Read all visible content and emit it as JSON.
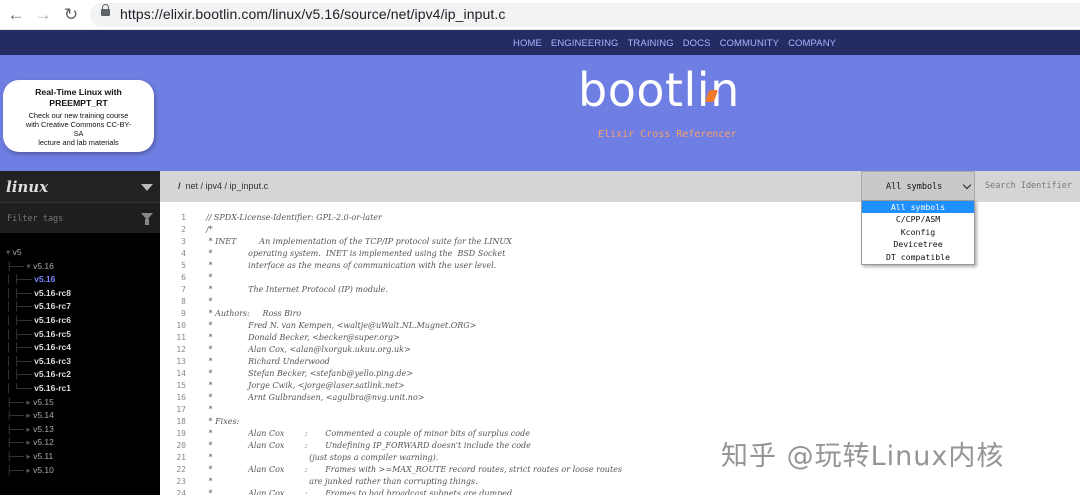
{
  "browser": {
    "url": "https://elixir.bootlin.com/linux/v5.16/source/net/ipv4/ip_input.c",
    "back_icon": "←",
    "forward_icon": "→",
    "reload_icon": "↻"
  },
  "topnav": [
    "HOME",
    "ENGINEERING",
    "TRAINING",
    "DOCS",
    "COMMUNITY",
    "COMPANY"
  ],
  "header": {
    "logo": "bootlin",
    "subtitle": "Elixir Cross Referencer"
  },
  "promo": {
    "title1": "Real-Time Linux with",
    "title2": "PREEMPT_RT",
    "body": [
      "Check our new training course",
      "with Creative Commons CC-BY-",
      "SA",
      "lecture and lab materials"
    ]
  },
  "sidebar": {
    "project": "linux",
    "filter_placeholder": "Filter tags",
    "tree": [
      {
        "lead": "▾ ",
        "text": "v5",
        "cls": ""
      },
      {
        "lead": "├── ▾ ",
        "text": "v5.16",
        "cls": ""
      },
      {
        "lead": "│   ├── ",
        "text": "v5.16",
        "cls": "sel"
      },
      {
        "lead": "│   ├── ",
        "text": "v5.16-rc8",
        "cls": "tag"
      },
      {
        "lead": "│   ├── ",
        "text": "v5.16-rc7",
        "cls": "tag"
      },
      {
        "lead": "│   ├── ",
        "text": "v5.16-rc6",
        "cls": "tag"
      },
      {
        "lead": "│   ├── ",
        "text": "v5.16-rc5",
        "cls": "tag"
      },
      {
        "lead": "│   ├── ",
        "text": "v5.16-rc4",
        "cls": "tag"
      },
      {
        "lead": "│   ├── ",
        "text": "v5.16-rc3",
        "cls": "tag"
      },
      {
        "lead": "│   ├── ",
        "text": "v5.16-rc2",
        "cls": "tag"
      },
      {
        "lead": "│   └── ",
        "text": "v5.16-rc1",
        "cls": "tag"
      },
      {
        "lead": "├── ▸ ",
        "text": "v5.15",
        "cls": ""
      },
      {
        "lead": "├── ▸ ",
        "text": "v5.14",
        "cls": ""
      },
      {
        "lead": "├── ▸ ",
        "text": "v5.13",
        "cls": ""
      },
      {
        "lead": "├── ▸ ",
        "text": "v5.12",
        "cls": ""
      },
      {
        "lead": "├── ▸ ",
        "text": "v5.11",
        "cls": ""
      },
      {
        "lead": "├── ▸ ",
        "text": "v5.10",
        "cls": ""
      }
    ]
  },
  "breadcrumb": {
    "root": "/",
    "path": "net / ipv4 / ip_input.c"
  },
  "symbols": {
    "selected": "All symbols",
    "options": [
      "All symbols",
      "C/CPP/ASM",
      "Kconfig",
      "Devicetree",
      "DT compatible"
    ],
    "search_placeholder": "Search Identifier"
  },
  "code": [
    {
      "n": "1",
      "t": "// SPDX-License-Identifier: GPL-2.0-or-later"
    },
    {
      "n": "2",
      "t": "/*"
    },
    {
      "n": "3",
      "t": " * INET         An implementation of the TCP/IP protocol suite for the LINUX"
    },
    {
      "n": "4",
      "t": " *              operating system.  INET is implemented using the  BSD Socket"
    },
    {
      "n": "5",
      "t": " *              interface as the means of communication with the user level."
    },
    {
      "n": "6",
      "t": " *"
    },
    {
      "n": "7",
      "t": " *              The Internet Protocol (IP) module."
    },
    {
      "n": "8",
      "t": " *"
    },
    {
      "n": "9",
      "t": " * Authors:     Ross Biro"
    },
    {
      "n": "10",
      "t": " *              Fred N. van Kempen, <waltje@uWalt.NL.Mugnet.ORG>"
    },
    {
      "n": "11",
      "t": " *              Donald Becker, <becker@super.org>"
    },
    {
      "n": "12",
      "t": " *              Alan Cox, <alan@lxorguk.ukuu.org.uk>"
    },
    {
      "n": "13",
      "t": " *              Richard Underwood"
    },
    {
      "n": "14",
      "t": " *              Stefan Becker, <stefanb@yello.ping.de>"
    },
    {
      "n": "15",
      "t": " *              Jorge Cwik, <jorge@laser.satlink.net>"
    },
    {
      "n": "16",
      "t": " *              Arnt Gulbrandsen, <agulbra@nvg.unit.no>"
    },
    {
      "n": "17",
      "t": " *"
    },
    {
      "n": "18",
      "t": " * Fixes:"
    },
    {
      "n": "19",
      "t": " *              Alan Cox        :       Commented a couple of minor bits of surplus code"
    },
    {
      "n": "20",
      "t": " *              Alan Cox        :       Undefining IP_FORWARD doesn't include the code"
    },
    {
      "n": "21",
      "t": " *                                      (just stops a compiler warning)."
    },
    {
      "n": "22",
      "t": " *              Alan Cox        :       Frames with >=MAX_ROUTE record routes, strict routes or loose routes"
    },
    {
      "n": "23",
      "t": " *                                      are junked rather than corrupting things."
    },
    {
      "n": "24",
      "t": " *              Alan Cox        :       Frames to bad broadcast subnets are dumped"
    }
  ],
  "watermark": "知乎 @玩转Linux内核"
}
